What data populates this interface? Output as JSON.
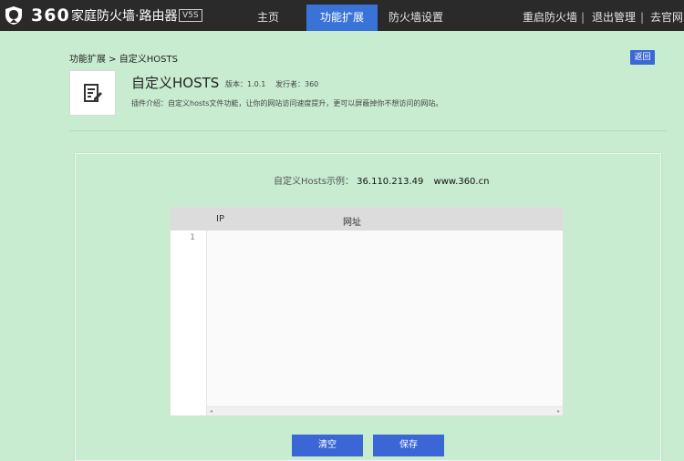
{
  "header": {
    "logo_number": "360",
    "logo_text": "家庭防火墙·路由器",
    "logo_badge": "V5S",
    "nav": [
      {
        "label": "主页"
      },
      {
        "label": "功能扩展"
      },
      {
        "label": "防火墙设置"
      }
    ],
    "right_links": [
      {
        "label": "重启防火墙"
      },
      {
        "label": "退出管理"
      },
      {
        "label": "去官网"
      }
    ],
    "separator": "|"
  },
  "breadcrumb": "功能扩展 > 自定义HOSTS",
  "back_label": "返回",
  "plugin": {
    "title": "自定义HOSTS",
    "version": "版本：1.0.1",
    "publisher": "发行者：360",
    "description": "插件介绍：自定义hosts文件功能，让你的网站访问速度提升，更可以屏蔽掉你不想访问的网站。"
  },
  "example": {
    "label": "自定义Hosts示例：",
    "ip": "36.110.213.49",
    "domain": "www.360.cn"
  },
  "editor": {
    "col_ip": "IP",
    "col_url": "网址",
    "line_number": "1",
    "scroll_left": "◂",
    "scroll_right": "▸"
  },
  "buttons": {
    "clear": "清空",
    "save": "保存"
  },
  "colors": {
    "background": "#c8ecd0",
    "topbar": "#2a2a2a",
    "accent": "#3a66d6"
  },
  "icons": [
    "shield-icon",
    "edit-document-icon"
  ]
}
